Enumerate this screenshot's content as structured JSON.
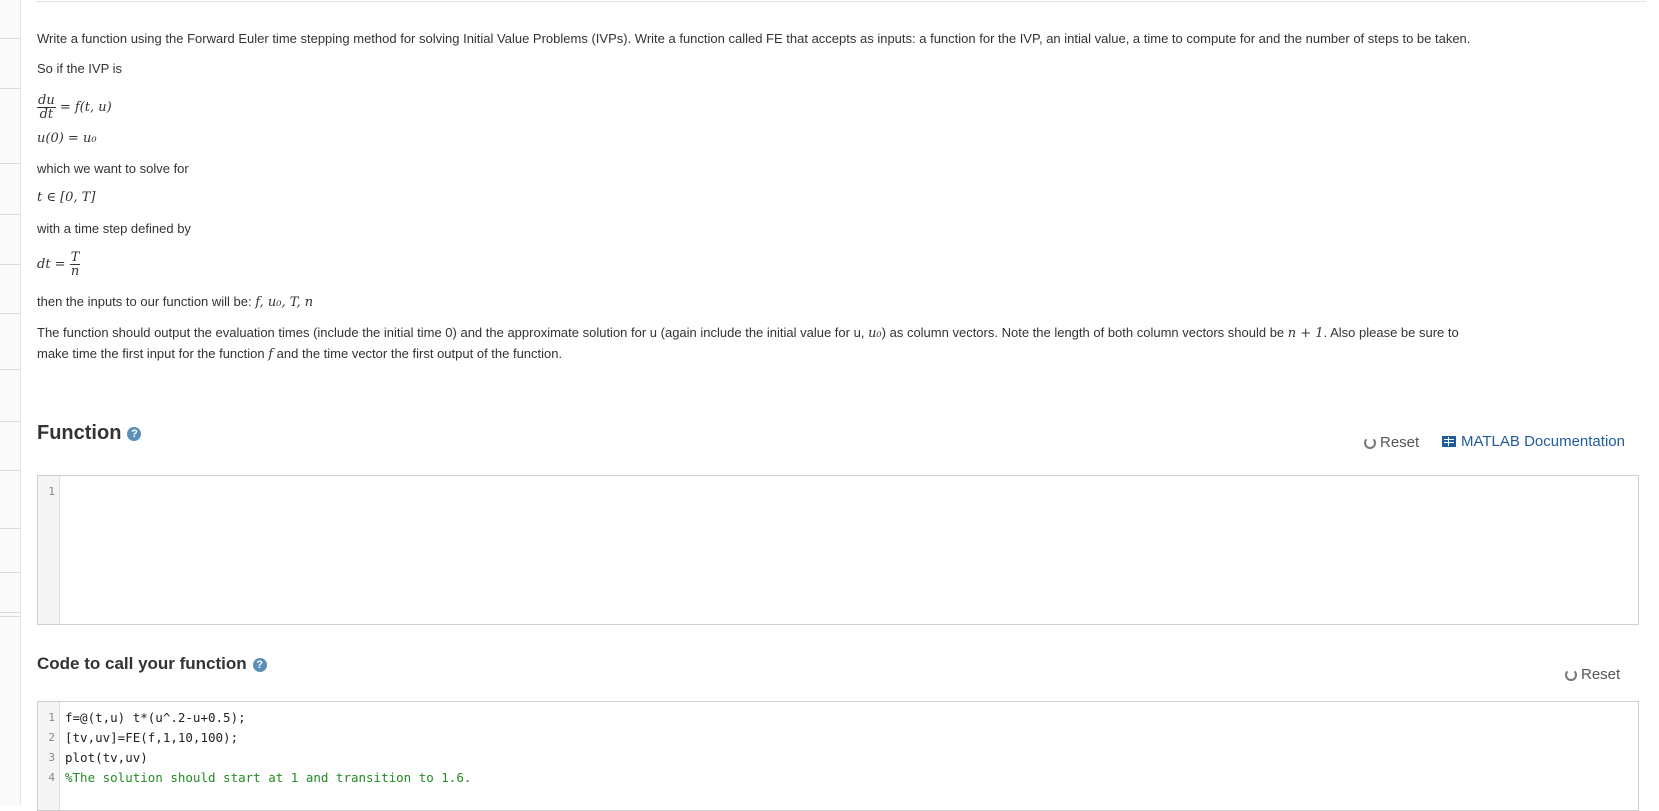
{
  "problem": {
    "intro": "Write a function using the Forward Euler time stepping method for solving Initial Value Problems (IVPs). Write a function called FE that accepts as inputs: a function for the IVP, an intial value, a time to compute for and the number of steps to be taken.",
    "so_if": "So if the IVP is",
    "eq1_num": "du",
    "eq1_den": "dt",
    "eq1_rhs": "= f(t, u)",
    "eq2": "u(0) = u₀",
    "which": "which we want to solve for",
    "eq3": "t ∈ [0, T]",
    "with_step": "with a time step defined by",
    "eq4_lhs": "dt =",
    "eq4_num": "T",
    "eq4_den": "n",
    "inputs_text": "then the inputs to our function will be:",
    "inputs_math": "f, u₀, T, n",
    "output_line1_a": "The function should output the evaluation times (include the initial time 0) and the approximate solution for u (again include the initial value for u,",
    "output_line1_m1": "u₀",
    "output_line1_b": ") as column vectors. Note the length of both column vectors should be",
    "output_line1_m2": "n + 1",
    "output_line1_c": ". Also please be sure to",
    "output_line2_a": "make time the first input for the function",
    "output_line2_m": "f",
    "output_line2_b": "and the time vector the first output of the function."
  },
  "function_section": {
    "title": "Function",
    "help": "?",
    "reset_label": "Reset",
    "doc_label": "MATLAB Documentation",
    "lines": [
      {
        "num": "1",
        "text": ""
      }
    ]
  },
  "call_section": {
    "title": "Code to call your function",
    "help": "?",
    "reset_label": "Reset",
    "lines": [
      {
        "num": "1",
        "text": "f=@(t,u) t*(u^.2-u+0.5);"
      },
      {
        "num": "2",
        "text": "[tv,uv]=FE(f,1,10,100);"
      },
      {
        "num": "3",
        "text": "plot(tv,uv)"
      },
      {
        "num": "4",
        "text": "%The solution should start at 1 and transition to 1.6."
      }
    ]
  }
}
